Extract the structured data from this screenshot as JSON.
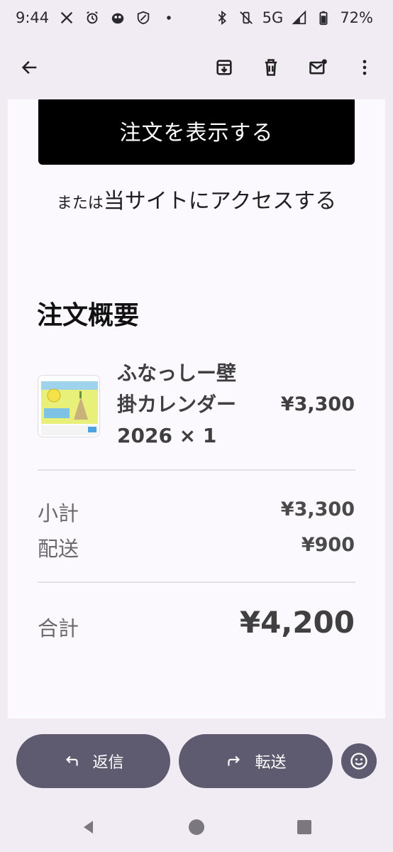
{
  "status_bar": {
    "time": "9:44",
    "network": "5G",
    "battery": "72%"
  },
  "app_bar": {
    "icons": [
      "back-arrow-icon",
      "archive-icon",
      "trash-icon",
      "mark-unread-icon",
      "more-vert-icon"
    ]
  },
  "email": {
    "view_order_label": "注文を表示する",
    "access_prefix": "または",
    "access_link": "当サイトにアクセスする",
    "summary_title": "注文概要",
    "product": {
      "name_line1": "ふなっしー壁",
      "name_line2": "掛カレンダー",
      "name_line3": "2026 × 1",
      "price": "¥3,300"
    },
    "subtotal_label": "小計",
    "subtotal_value": "¥3,300",
    "shipping_label": "配送",
    "shipping_value": "¥900",
    "total_label": "合計",
    "total_value": "¥4,200"
  },
  "actions": {
    "reply_label": "返信",
    "forward_label": "転送"
  },
  "colors": {
    "background": "#f1ecf4",
    "card": "#fbf9fd",
    "pill": "#5e5a70",
    "primary_button": "#000000"
  }
}
